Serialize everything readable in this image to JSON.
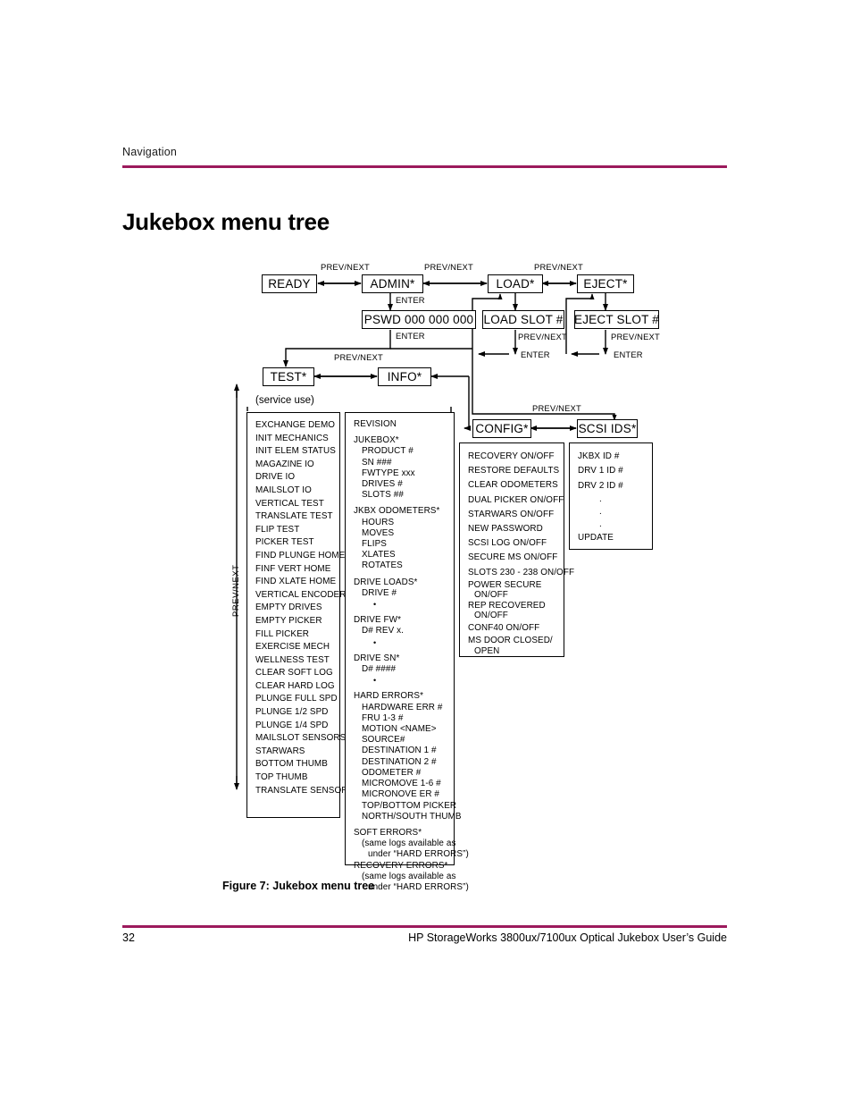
{
  "header": {
    "running_head": "Navigation",
    "rule_color": "#9c1a5c"
  },
  "page_title": "Jukebox menu tree",
  "caption": "Figure 7:  Jukebox menu tree",
  "footer": {
    "page_number": "32",
    "guide_title": "HP StorageWorks 3800ux/7100ux Optical Jukebox User’s Guide"
  },
  "diagram": {
    "service_note": "(service use)",
    "nodes": {
      "ready": "READY",
      "admin": "ADMIN*",
      "load": "LOAD*",
      "eject": "EJECT*",
      "pswd": "PSWD 000 000 000",
      "load_slot": "LOAD SLOT #",
      "eject_slot": "EJECT SLOT #",
      "test": "TEST*",
      "info": "INFO*",
      "config": "CONFIG*",
      "scsi_ids": "SCSI IDS*"
    },
    "edge_labels": {
      "prevnext": "PREV/NEXT",
      "enter": "ENTER",
      "prevnext_vertical": "PREV/NEXT"
    },
    "test_menu": [
      "EXCHANGE DEMO",
      "INIT MECHANICS",
      "INIT ELEM STATUS",
      "MAGAZINE IO",
      "DRIVE IO",
      "MAILSLOT IO",
      "VERTICAL TEST",
      "TRANSLATE TEST",
      "FLIP TEST",
      "PICKER TEST",
      "FIND PLUNGE HOME",
      "FINF VERT HOME",
      "FIND XLATE HOME",
      "VERTICAL ENCODER",
      "EMPTY DRIVES",
      "EMPTY PICKER",
      "FILL PICKER",
      "EXERCISE MECH",
      "WELLNESS TEST",
      "CLEAR SOFT LOG",
      "CLEAR HARD LOG",
      "PLUNGE FULL SPD",
      "PLUNGE 1/2 SPD",
      "PLUNGE 1/4 SPD",
      "MAILSLOT SENSORS",
      "STARWARS",
      "BOTTOM THUMB",
      "TOP THUMB",
      "TRANSLATE SENSOR"
    ],
    "info_menu": [
      {
        "text": "REVISION",
        "indent": 0,
        "gap": false
      },
      {
        "text": "JUKEBOX*",
        "indent": 0,
        "gap": true
      },
      {
        "text": "PRODUCT #",
        "indent": 1,
        "gap": false
      },
      {
        "text": "SN ###",
        "indent": 1,
        "gap": false
      },
      {
        "text": "FWTYPE xxx",
        "indent": 1,
        "gap": false
      },
      {
        "text": "DRIVES #",
        "indent": 1,
        "gap": false
      },
      {
        "text": "SLOTS ##",
        "indent": 1,
        "gap": false
      },
      {
        "text": "JKBX ODOMETERS*",
        "indent": 0,
        "gap": true
      },
      {
        "text": "HOURS",
        "indent": 1,
        "gap": false
      },
      {
        "text": "MOVES",
        "indent": 1,
        "gap": false
      },
      {
        "text": "FLIPS",
        "indent": 1,
        "gap": false
      },
      {
        "text": "XLATES",
        "indent": 1,
        "gap": false
      },
      {
        "text": "ROTATES",
        "indent": 1,
        "gap": false
      },
      {
        "text": "DRIVE LOADS*",
        "indent": 0,
        "gap": true
      },
      {
        "text": "DRIVE #",
        "indent": 1,
        "gap": false
      },
      {
        "text": "•",
        "indent": 2,
        "gap": false,
        "dot": true
      },
      {
        "text": "DRIVE FW*",
        "indent": 0,
        "gap": true
      },
      {
        "text": "D# REV x.",
        "indent": 1,
        "gap": false
      },
      {
        "text": "•",
        "indent": 2,
        "gap": false,
        "dot": true
      },
      {
        "text": "DRIVE SN*",
        "indent": 0,
        "gap": true
      },
      {
        "text": "D# ####",
        "indent": 1,
        "gap": false
      },
      {
        "text": "•",
        "indent": 2,
        "gap": false,
        "dot": true
      },
      {
        "text": "HARD ERRORS*",
        "indent": 0,
        "gap": true
      },
      {
        "text": "HARDWARE ERR #",
        "indent": 1,
        "gap": false
      },
      {
        "text": "FRU 1-3 #",
        "indent": 1,
        "gap": false
      },
      {
        "text": "MOTION <NAME>",
        "indent": 1,
        "gap": false
      },
      {
        "text": "SOURCE#",
        "indent": 1,
        "gap": false
      },
      {
        "text": "DESTINATION 1 #",
        "indent": 1,
        "gap": false
      },
      {
        "text": "DESTINATION 2 #",
        "indent": 1,
        "gap": false
      },
      {
        "text": "ODOMETER #",
        "indent": 1,
        "gap": false
      },
      {
        "text": "MICROMOVE 1-6 #",
        "indent": 1,
        "gap": false
      },
      {
        "text": "MICRONOVE ER #",
        "indent": 1,
        "gap": false
      },
      {
        "text": "TOP/BOTTOM PICKER",
        "indent": 1,
        "gap": false
      },
      {
        "text": "NORTH/SOUTH THUMB",
        "indent": 1,
        "gap": false
      },
      {
        "text": "SOFT ERRORS*",
        "indent": 0,
        "gap": true
      },
      {
        "text": "(same logs available as",
        "indent": 1,
        "gap": false
      },
      {
        "text": "under “HARD ERRORS”)",
        "indent": 2,
        "gap": false
      },
      {
        "text": "RECOVERY ERRORS*",
        "indent": 0,
        "gap": false
      },
      {
        "text": "(same logs available as",
        "indent": 1,
        "gap": false
      },
      {
        "text": "under “HARD ERRORS”)",
        "indent": 2,
        "gap": false
      }
    ],
    "config_menu": [
      {
        "text": "RECOVERY ON/OFF",
        "sub": false
      },
      {
        "text": "RESTORE DEFAULTS",
        "sub": false
      },
      {
        "text": "CLEAR ODOMETERS",
        "sub": false
      },
      {
        "text": "DUAL PICKER ON/OFF",
        "sub": false
      },
      {
        "text": "STARWARS ON/OFF",
        "sub": false
      },
      {
        "text": "NEW PASSWORD",
        "sub": false
      },
      {
        "text": "SCSI LOG ON/OFF",
        "sub": false
      },
      {
        "text": "SECURE MS ON/OFF",
        "sub": false
      },
      {
        "text": "SLOTS 230 - 238 ON/OFF",
        "sub": false
      },
      {
        "text": "POWER SECURE",
        "sub": false,
        "two": true
      },
      {
        "text": "ON/OFF",
        "sub": true
      },
      {
        "text": "REP RECOVERED",
        "sub": false,
        "two": true
      },
      {
        "text": "ON/OFF",
        "sub": true
      },
      {
        "text": "CONF40 ON/OFF",
        "sub": false
      },
      {
        "text": "MS DOOR CLOSED/",
        "sub": false,
        "two": true
      },
      {
        "text": "OPEN",
        "sub": true
      }
    ],
    "scsi_menu": [
      {
        "text": "JKBX ID #",
        "mid": false
      },
      {
        "text": "DRV 1 ID #",
        "mid": false
      },
      {
        "text": "DRV 2 ID #",
        "mid": false
      },
      {
        "text": ".",
        "mid": true
      },
      {
        "text": ".",
        "mid": true
      },
      {
        "text": ".",
        "mid": true
      },
      {
        "text": "UPDATE",
        "mid": false
      }
    ]
  }
}
